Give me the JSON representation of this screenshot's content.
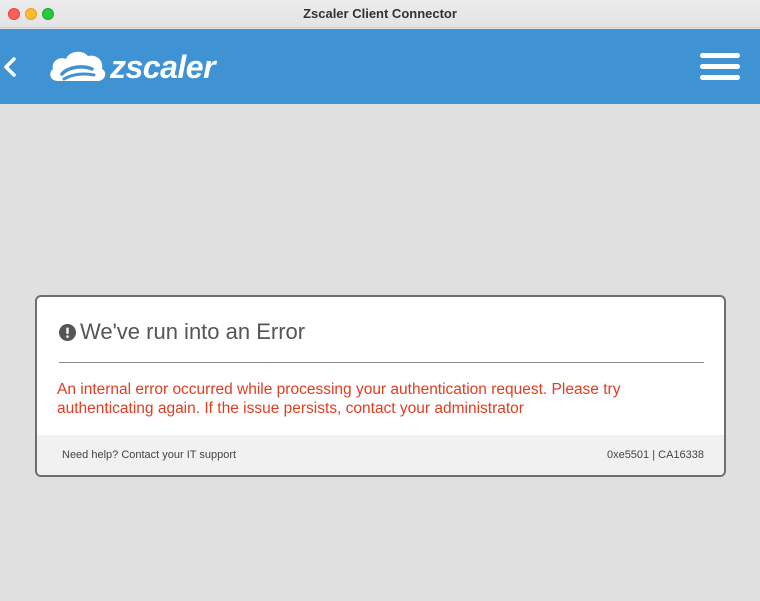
{
  "window": {
    "title": "Zscaler Client Connector"
  },
  "header": {
    "logo_text": "zscaler",
    "back_icon": "chevron-left-icon",
    "menu_icon": "hamburger-menu-icon",
    "background_color": "#3f93d2"
  },
  "error_card": {
    "icon": "exclamation-circle-icon",
    "title": "We've run into an Error",
    "message": "An internal error occurred while processing your authentication request. Please try authenticating again. If the issue persists, contact your administrator",
    "message_color": "#e23c1f",
    "help_text": "Need help? Contact your IT support",
    "error_code": "0xe5501 | CA16338"
  }
}
